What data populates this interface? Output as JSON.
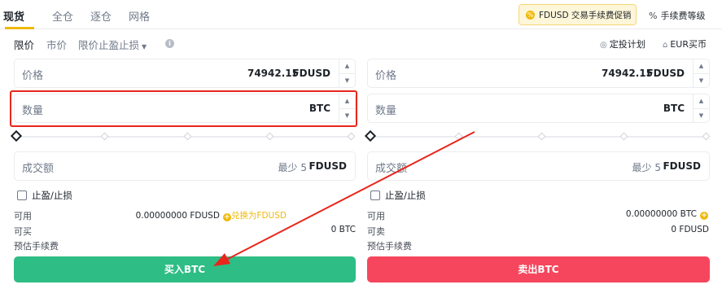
{
  "tabs": [
    "现货",
    "全仓",
    "逐仓",
    "网格"
  ],
  "promo": {
    "text": "FDUSD 交易手续费促销"
  },
  "fee_level": {
    "text": "手续费等级"
  },
  "order_types": {
    "limit": "限价",
    "market": "市价",
    "stop_limit": "限价止盈止损"
  },
  "right_links": {
    "plan": "定投计划",
    "eur": "EUR买币"
  },
  "buy": {
    "price_label": "价格",
    "price_value": "74942.15",
    "price_unit": "FDUSD",
    "amount_label": "数量",
    "amount_unit": "BTC",
    "total_label": "成交额",
    "total_min": "最少 5",
    "total_unit": "FDUSD",
    "tp_sl": "止盈/止损",
    "available_label": "可用",
    "available_value": "0.00000000 FDUSD",
    "convert": "兑换为FDUSD",
    "can_buy_label": "可买",
    "can_buy_value": "0 BTC",
    "fee_label": "预估手续费",
    "button": "买入BTC"
  },
  "sell": {
    "price_label": "价格",
    "price_value": "74942.15",
    "price_unit": "FDUSD",
    "amount_label": "数量",
    "amount_unit": "BTC",
    "total_label": "成交额",
    "total_min": "最少 5",
    "total_unit": "FDUSD",
    "tp_sl": "止盈/止损",
    "available_label": "可用",
    "available_value": "0.00000000 BTC",
    "can_sell_label": "可卖",
    "can_sell_value": "0 FDUSD",
    "fee_label": "预估手续费",
    "button": "卖出BTC"
  },
  "colors": {
    "accent": "#f0b90b",
    "buy": "#2ebd85",
    "sell": "#f6465d",
    "highlight": "#e8261c"
  }
}
